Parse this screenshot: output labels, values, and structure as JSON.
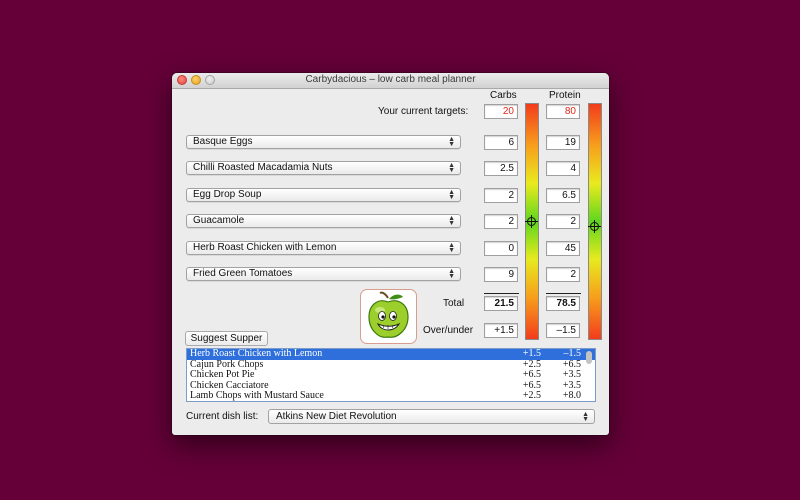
{
  "window": {
    "title": "Carbydacious – low carb meal planner"
  },
  "columns": {
    "carbs": "Carbs",
    "protein": "Protein"
  },
  "targets": {
    "label": "Your current targets:",
    "carbs": "20",
    "protein": "80"
  },
  "dishes": [
    {
      "name": "Basque Eggs",
      "carbs": "6",
      "protein": "19"
    },
    {
      "name": "Chilli Roasted Macadamia Nuts",
      "carbs": "2.5",
      "protein": "4"
    },
    {
      "name": "Egg Drop Soup",
      "carbs": "2",
      "protein": "6.5"
    },
    {
      "name": "Guacamole",
      "carbs": "2",
      "protein": "2"
    },
    {
      "name": "Herb Roast Chicken with Lemon",
      "carbs": "0",
      "protein": "45"
    },
    {
      "name": "Fried Green Tomatoes",
      "carbs": "9",
      "protein": "2"
    }
  ],
  "totals": {
    "label": "Total",
    "carbs": "21.5",
    "protein": "78.5"
  },
  "overunder": {
    "label": "Over/under",
    "carbs": "+1.5",
    "protein": "–1.5"
  },
  "gauges": {
    "carbs_level": 0.5,
    "protein_level": 0.52
  },
  "suggest_button": "Suggest Supper",
  "suggestions": [
    {
      "name": "Herb Roast Chicken with Lemon",
      "carbs": "+1.5",
      "protein": "–1.5",
      "selected": true
    },
    {
      "name": "Cajun Pork Chops",
      "carbs": "+2.5",
      "protein": "+6.5"
    },
    {
      "name": "Chicken Pot Pie",
      "carbs": "+6.5",
      "protein": "+3.5"
    },
    {
      "name": "Chicken Cacciatore",
      "carbs": "+6.5",
      "protein": "+3.5"
    },
    {
      "name": "Lamb Chops with Mustard Sauce",
      "carbs": "+2.5",
      "protein": "+8.0"
    }
  ],
  "dish_list": {
    "label": "Current dish list:",
    "value": "Atkins New Diet Revolution"
  },
  "icons": {
    "close": "close-icon",
    "minimize": "minimize-icon",
    "zoom": "zoom-icon",
    "mascot": "smiling-apple-icon",
    "popup-arrows": "chevron-updown-icon",
    "gauge-marker": "crosshair-icon"
  },
  "colors": {
    "background": "#650038",
    "selection": "#2f6fdb",
    "target_text": "#e0281b"
  }
}
